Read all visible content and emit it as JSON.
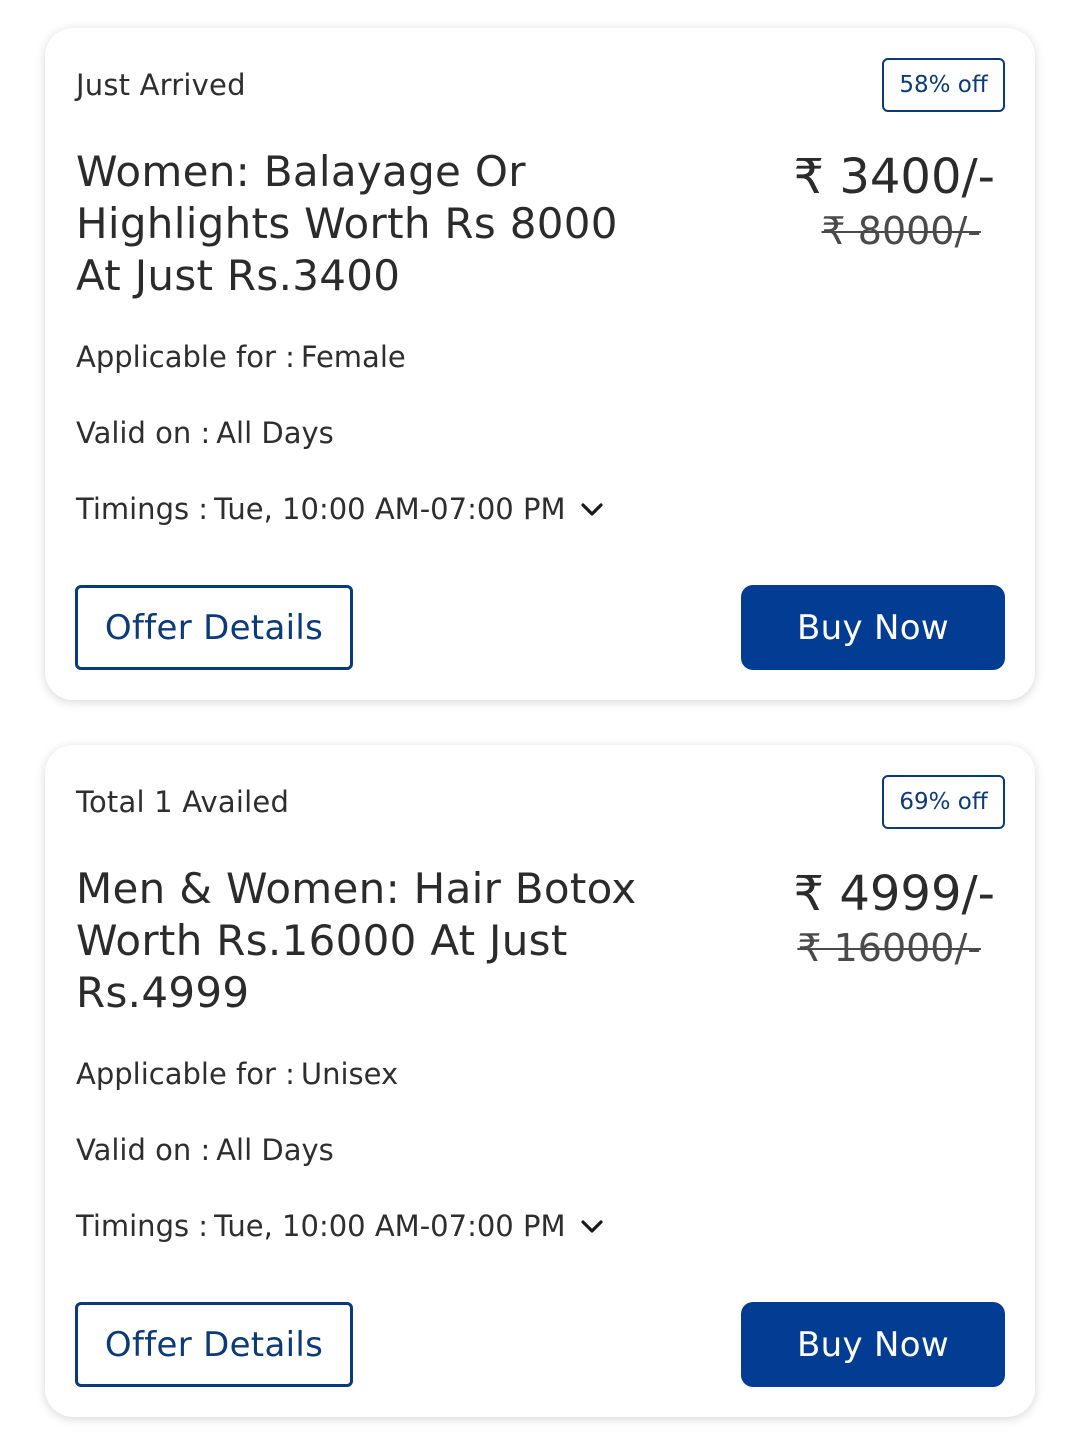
{
  "offers": [
    {
      "tag": "Just Arrived",
      "discount": "58% off",
      "title": "Women: Balayage Or Highlights Worth Rs 8000 At Just Rs.3400",
      "price_now": "₹ 3400/-",
      "price_was": "₹ 8000/-",
      "applicable_label": "Applicable for :",
      "applicable_value": "Female",
      "valid_label": "Valid on :",
      "valid_value": "All Days",
      "timings_label": "Timings :",
      "timings_value": "Tue, 10:00 AM-07:00 PM",
      "offer_details_label": "Offer Details",
      "buy_now_label": "Buy Now"
    },
    {
      "tag": "Total 1 Availed",
      "discount": "69% off",
      "title": "Men & Women: Hair Botox Worth Rs.16000 At Just Rs.4999",
      "price_now": "₹ 4999/-",
      "price_was": "₹ 16000/-",
      "applicable_label": "Applicable for :",
      "applicable_value": "Unisex",
      "valid_label": "Valid on :",
      "valid_value": "All Days",
      "timings_label": "Timings :",
      "timings_value": "Tue, 10:00 AM-07:00 PM",
      "offer_details_label": "Offer Details",
      "buy_now_label": "Buy Now"
    }
  ],
  "icons": {
    "timings_toggle": "chevron-down-icon"
  },
  "colors": {
    "brand_blue": "#023d93",
    "outline_blue": "#0b3a7a"
  }
}
